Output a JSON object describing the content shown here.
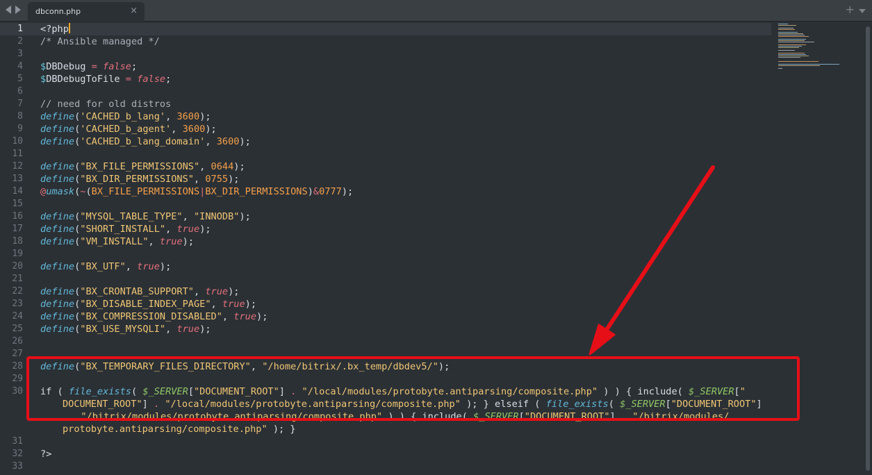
{
  "tab": {
    "filename": "dbconn.php",
    "close_glyph": "×",
    "new_tab_glyph": "+"
  },
  "editor": {
    "active_line": 1,
    "line_numbers": [
      "1",
      "2",
      "3",
      "4",
      "5",
      "6",
      "7",
      "8",
      "9",
      "10",
      "11",
      "12",
      "13",
      "14",
      "15",
      "16",
      "17",
      "18",
      "19",
      "20",
      "21",
      "22",
      "23",
      "24",
      "25",
      "26",
      "27",
      "28",
      "29",
      "30",
      "31",
      "32",
      "33"
    ]
  },
  "code": {
    "l1": [
      "<?php"
    ],
    "l2": [
      "/* Ansible managed */"
    ],
    "l4": [
      "$",
      "DBDebug",
      " = ",
      "false",
      ";"
    ],
    "l5": [
      "$",
      "DBDebugToFile",
      " = ",
      "false",
      ";"
    ],
    "l7": [
      "// need for old distros"
    ],
    "l8": [
      "define",
      "(",
      "'CACHED_b_lang'",
      ", ",
      "3600",
      ");"
    ],
    "l9": [
      "define",
      "(",
      "'CACHED_b_agent'",
      ", ",
      "3600",
      ");"
    ],
    "l10": [
      "define",
      "(",
      "'CACHED_b_lang_domain'",
      ", ",
      "3600",
      ");"
    ],
    "l12": [
      "define",
      "(",
      "\"BX_FILE_PERMISSIONS\"",
      ", ",
      "0644",
      ");"
    ],
    "l13": [
      "define",
      "(",
      "\"BX_DIR_PERMISSIONS\"",
      ", ",
      "0755",
      ");"
    ],
    "l14": [
      "@",
      "umask",
      "(",
      "~",
      "(",
      "BX_FILE_PERMISSIONS",
      "|",
      "BX_DIR_PERMISSIONS",
      ")",
      "&",
      "0777",
      ");"
    ],
    "l16": [
      "define",
      "(",
      "\"MYSQL_TABLE_TYPE\"",
      ", ",
      "\"INNODB\"",
      ");"
    ],
    "l17": [
      "define",
      "(",
      "\"SHORT_INSTALL\"",
      ", ",
      "true",
      ");"
    ],
    "l18": [
      "define",
      "(",
      "\"VM_INSTALL\"",
      ", ",
      "true",
      ");"
    ],
    "l20": [
      "define",
      "(",
      "\"BX_UTF\"",
      ", ",
      "true",
      ");"
    ],
    "l22": [
      "define",
      "(",
      "\"BX_CRONTAB_SUPPORT\"",
      ", ",
      "true",
      ");"
    ],
    "l23": [
      "define",
      "(",
      "\"BX_DISABLE_INDEX_PAGE\"",
      ", ",
      "true",
      ");"
    ],
    "l24": [
      "define",
      "(",
      "\"BX_COMPRESSION_DISABLED\"",
      ", ",
      "true",
      ");"
    ],
    "l25": [
      "define",
      "(",
      "\"BX_USE_MYSQLI\"",
      ", ",
      "true",
      ");"
    ],
    "l28": [
      "define",
      "(",
      "\"BX_TEMPORARY_FILES_DIRECTORY\"",
      ", ",
      "\"/home/bitrix/.bx_temp/dbdev5/\"",
      ");"
    ],
    "l30a": [
      "if ( ",
      "file_exists",
      "( ",
      "$_SERVER",
      "[",
      "\"DOCUMENT_ROOT\"",
      "] ",
      ".",
      " ",
      "\"/local/modules/protobyte.antiparsing/composite.php\"",
      " ) ) { include( ",
      "$_SERVER",
      "[",
      "\""
    ],
    "l30b": [
      "DOCUMENT_ROOT\"",
      "] ",
      ".",
      " ",
      "\"/local/modules/protobyte.antiparsing/composite.php\"",
      " ); } elseif ( ",
      "file_exists",
      "( ",
      "$_SERVER",
      "[",
      "\"DOCUMENT_ROOT\"",
      "]"
    ],
    "l30c": [
      ".",
      " ",
      "\"/bitrix/modules/protobyte.antiparsing/composite.php\"",
      " ) ) { include( ",
      "$_SERVER",
      "[",
      "\"DOCUMENT_ROOT\"",
      "] ",
      ".",
      " ",
      "\"/bitrix/modules/"
    ],
    "l30d": [
      "protobyte.antiparsing/composite.php\"",
      " ); }"
    ],
    "l32": [
      "?>"
    ]
  },
  "colors": {
    "highlight_box": "#e60f17",
    "arrow": "#e60f17",
    "background": "#2b3035"
  }
}
